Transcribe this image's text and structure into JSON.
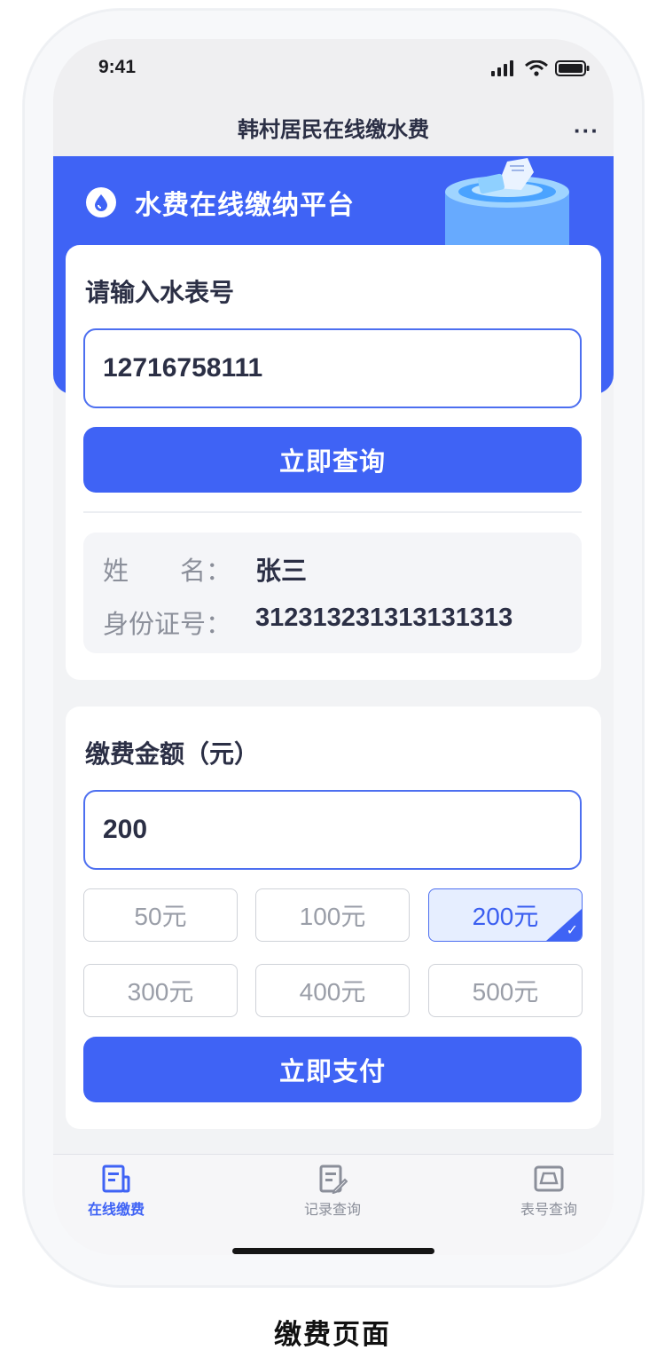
{
  "status_bar": {
    "time": "9:41"
  },
  "header": {
    "title": "韩村居民在线缴水费",
    "more": "···"
  },
  "banner": {
    "title": "水费在线缴纳平台"
  },
  "meter_section": {
    "label": "请输入水表号",
    "meter_number": "12716758111",
    "query_button": "立即查询"
  },
  "resident_info": {
    "name_label": "姓　　名：",
    "name_value": "张三",
    "id_label": "身份证号：",
    "id_value": "312313231313131313"
  },
  "payment_section": {
    "label": "缴费金额（元）",
    "amount": "200",
    "options": [
      "50元",
      "100元",
      "200元",
      "300元",
      "400元",
      "500元"
    ],
    "selected": "200元",
    "pay_button": "立即支付"
  },
  "tabbar": {
    "items": [
      {
        "label": "在线缴费",
        "icon": "bill-icon",
        "active": true
      },
      {
        "label": "记录查询",
        "icon": "record-edit-icon",
        "active": false
      },
      {
        "label": "表号查询",
        "icon": "meter-icon",
        "active": false
      }
    ]
  },
  "caption": "缴费页面",
  "colors": {
    "primary": "#3f63f5",
    "selected_bg": "#e6eeff",
    "text": "#2b2f45",
    "muted": "#8b8f9a"
  }
}
